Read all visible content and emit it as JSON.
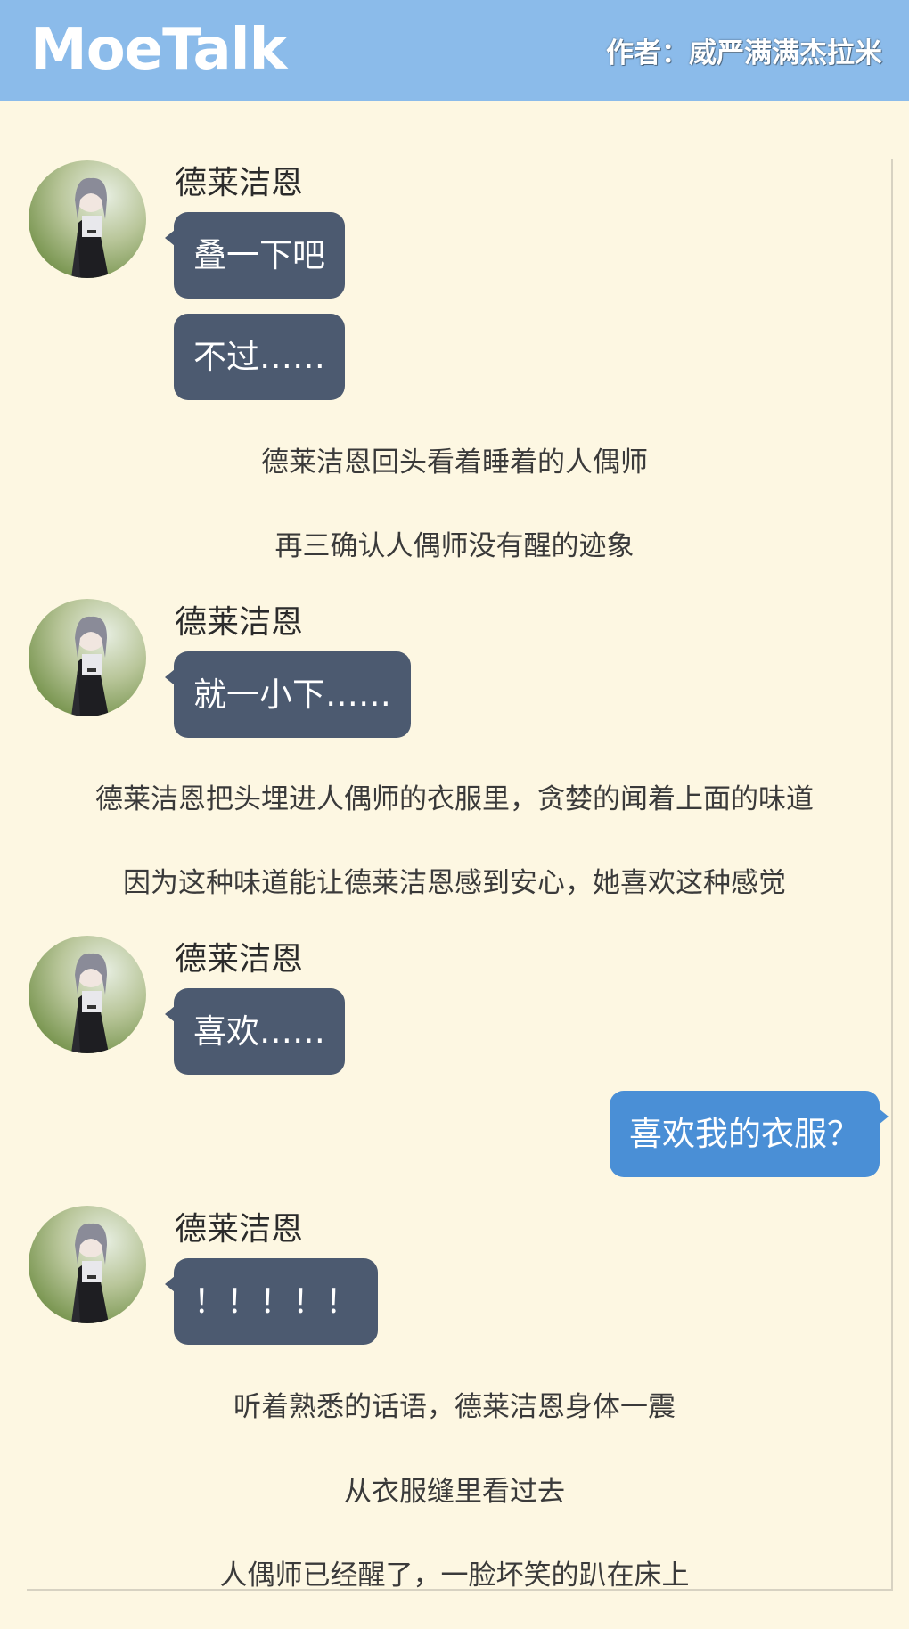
{
  "app": {
    "logo": "MoeTalk",
    "author": "作者：威严满满杰拉米"
  },
  "character": {
    "name": "德莱洁恩",
    "avatar_icon": "character-portrait-icon"
  },
  "messages": [
    {
      "type": "character",
      "name": "德莱洁恩",
      "lines": [
        "叠一下吧",
        "不过……"
      ]
    },
    {
      "type": "narration",
      "text": "德莱洁恩回头看着睡着的人偶师"
    },
    {
      "type": "narration",
      "text": "再三确认人偶师没有醒的迹象"
    },
    {
      "type": "character",
      "name": "德莱洁恩",
      "lines": [
        "就一小下……"
      ]
    },
    {
      "type": "narration",
      "text": "德莱洁恩把头埋进人偶师的衣服里，贪婪的闻着上面的味道"
    },
    {
      "type": "narration",
      "text": "因为这种味道能让德莱洁恩感到安心，她喜欢这种感觉"
    },
    {
      "type": "character",
      "name": "德莱洁恩",
      "lines": [
        "喜欢……"
      ]
    },
    {
      "type": "self",
      "text": "喜欢我的衣服？"
    },
    {
      "type": "character",
      "name": "德莱洁恩",
      "lines": [
        "！！！！！"
      ]
    },
    {
      "type": "narration",
      "text": "听着熟悉的话语，德莱洁恩身体一震"
    },
    {
      "type": "narration",
      "text": "从衣服缝里看过去"
    },
    {
      "type": "narration",
      "text": "人偶师已经醒了，一脸坏笑的趴在床上"
    }
  ],
  "colors": {
    "header": "#8bbbea",
    "background": "#fdf7e2",
    "character_bubble": "#4c5a70",
    "self_bubble": "#4a8fd6"
  }
}
